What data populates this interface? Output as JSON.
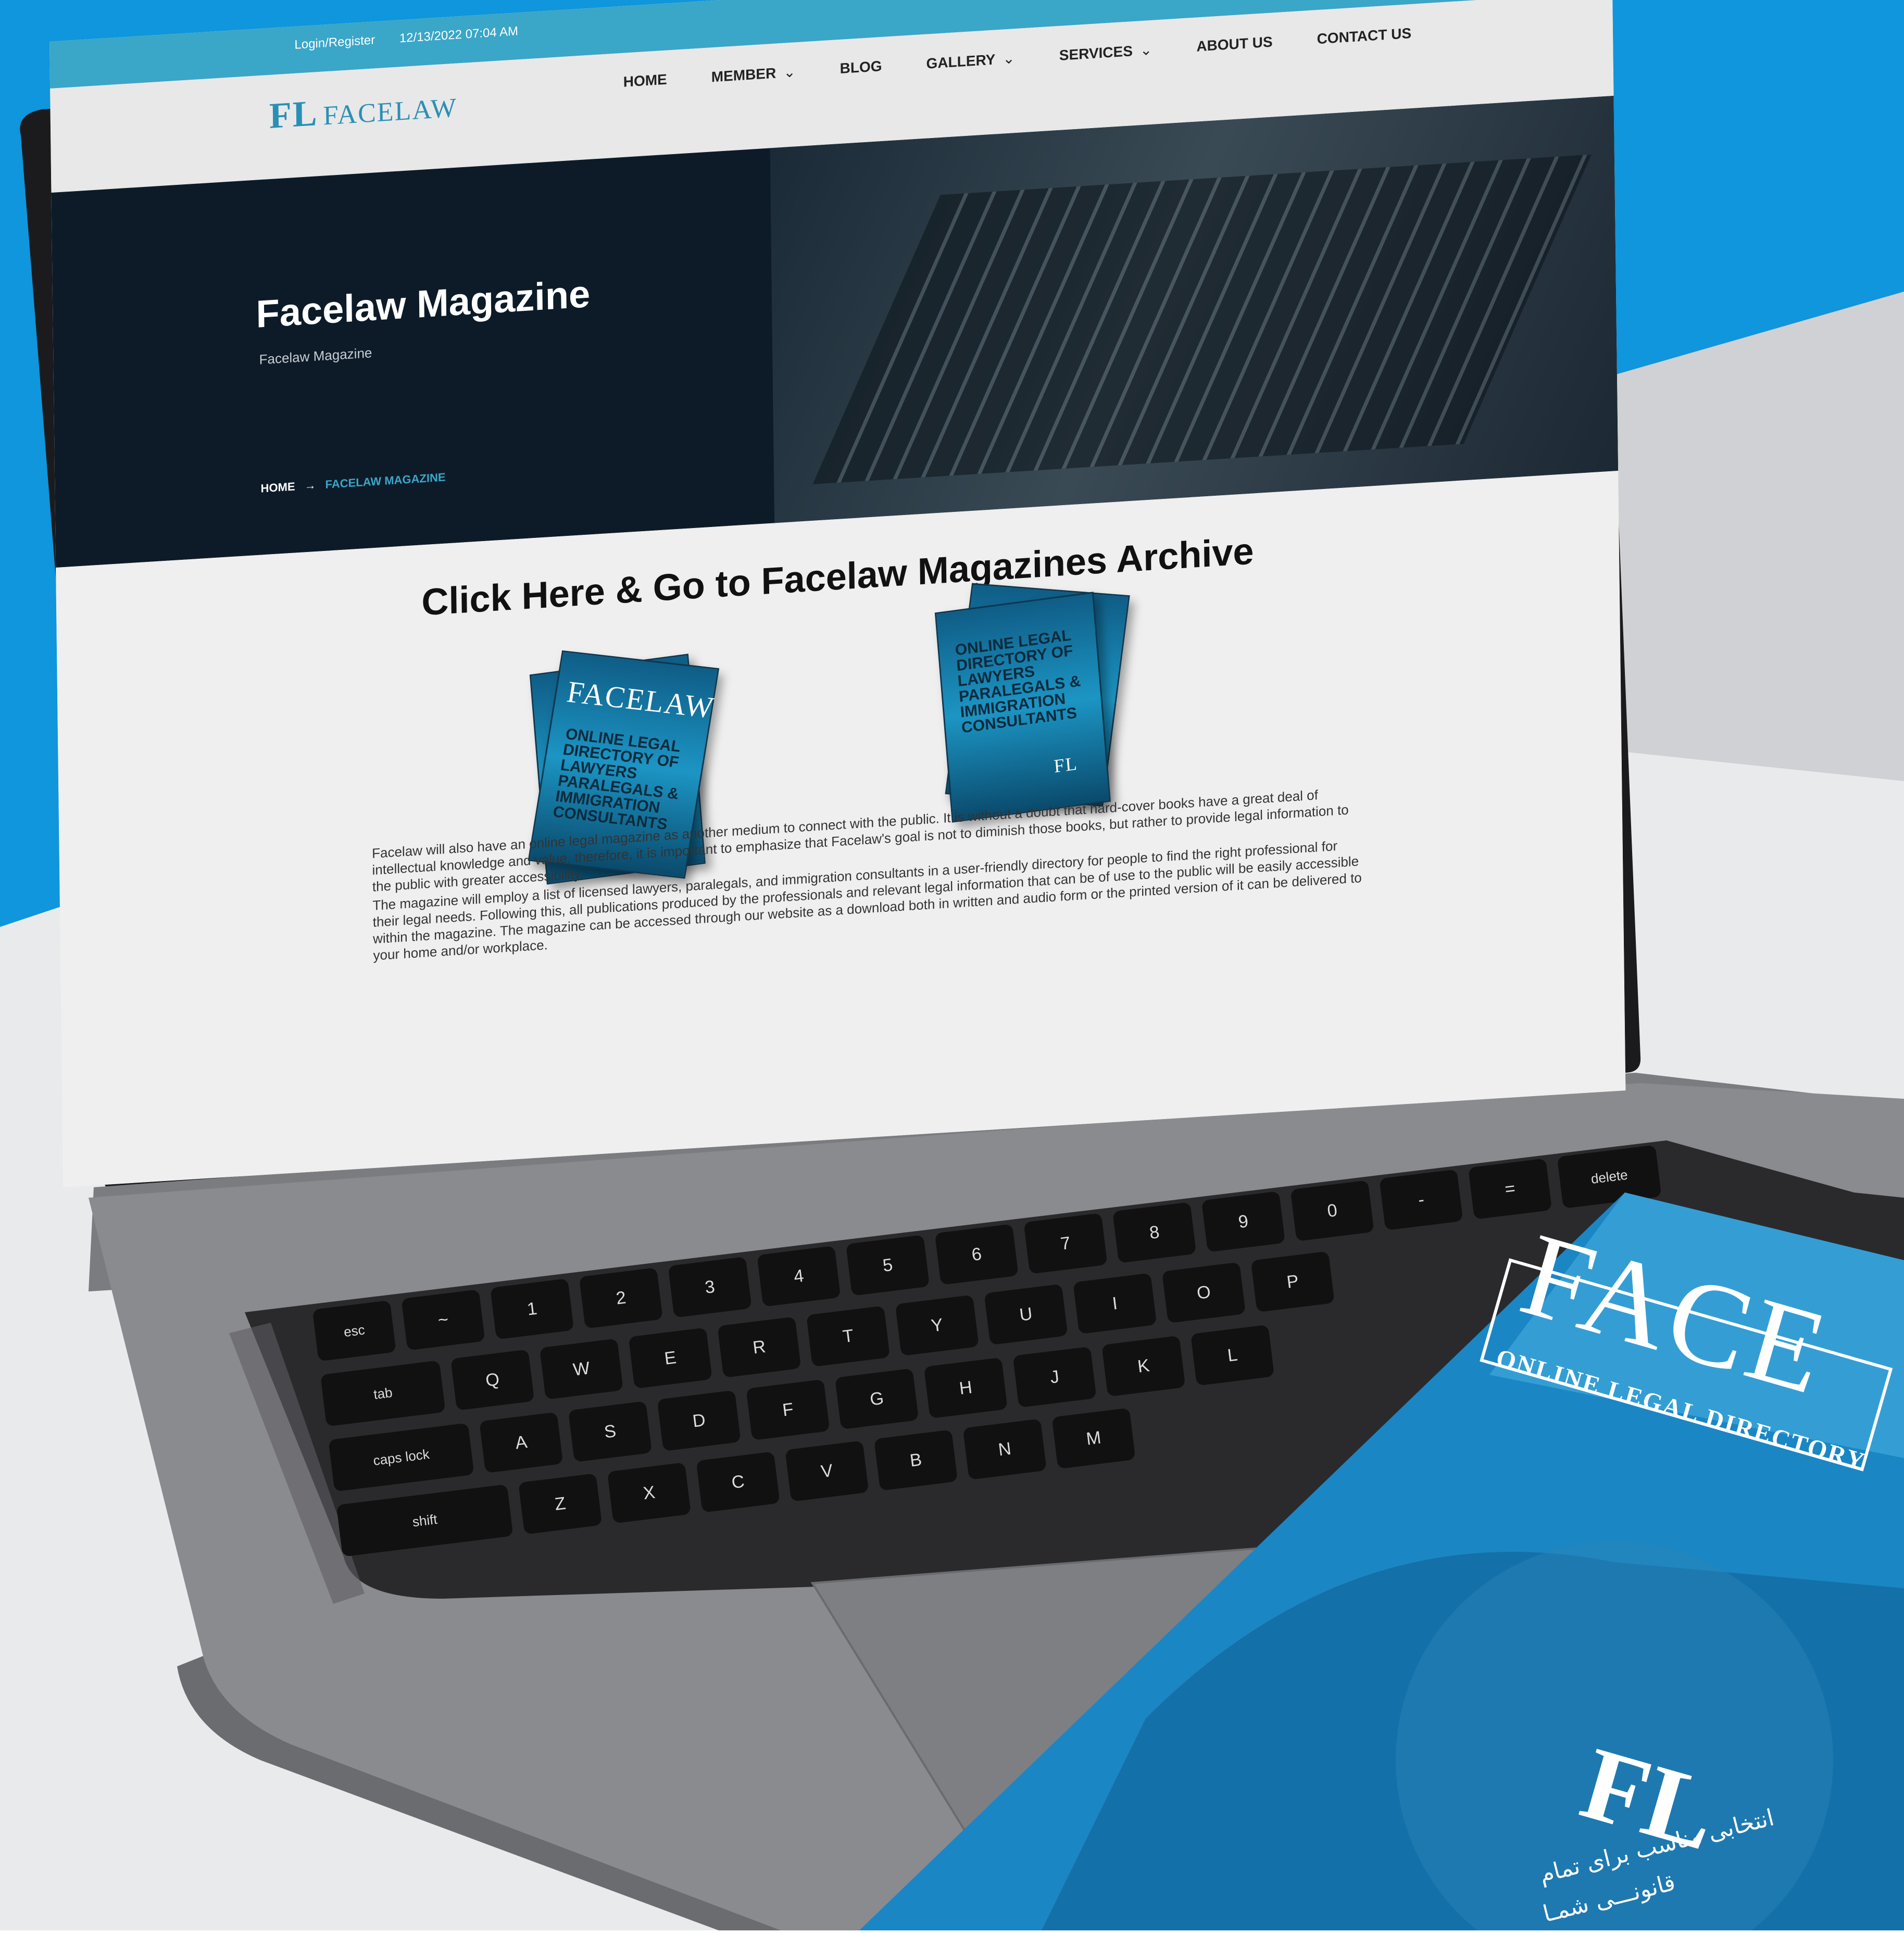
{
  "topbar": {
    "login_label": "Login/Register",
    "datetime": "12/13/2022 07:04 AM",
    "social_icons": [
      "instagram-icon",
      "youtube-icon",
      "facebook-icon"
    ]
  },
  "brand": {
    "mark": "FL",
    "name": "FACELAW",
    "color": "#2a8fb5"
  },
  "nav": {
    "items": [
      {
        "label": "HOME",
        "dropdown": false
      },
      {
        "label": "MEMBER",
        "dropdown": true
      },
      {
        "label": "BLOG",
        "dropdown": false
      },
      {
        "label": "GALLERY",
        "dropdown": true
      },
      {
        "label": "SERVICES",
        "dropdown": true
      },
      {
        "label": "ABOUT US",
        "dropdown": false
      },
      {
        "label": "CONTACT US",
        "dropdown": false
      }
    ]
  },
  "hero": {
    "title": "Facelaw Magazine",
    "subtitle": "Facelaw Magazine",
    "breadcrumb": {
      "home": "HOME",
      "arrow": "→",
      "current": "FACELAW MAGAZINE"
    }
  },
  "main": {
    "archive_link": "Click Here & Go to Facelaw Magazines Archive",
    "magazines": [
      {
        "cover_title": "FACELAW",
        "cover_text": "ONLINE LEGAL DIRECTORY OF LAWYERS PARALEGALS & IMMIGRATION CONSULTANTS"
      },
      {
        "cover_title": "FL",
        "cover_text": "ONLINE LEGAL DIRECTORY OF LAWYERS PARALEGALS & IMMIGRATION CONSULTANTS"
      }
    ],
    "paragraphs": [
      "Facelaw will also have an online legal magazine as another medium to connect with the public. It is without a doubt that hard-cover books have a great deal of intellectual knowledge and value, therefore, it is important to emphasize that Facelaw's goal is not to diminish those books, but rather to provide legal information to the public with greater accessibility.",
      "The magazine will employ a list of licensed lawyers, paralegals, and immigration consultants in a user-friendly directory for people to find the right professional for their legal needs. Following this, all publications produced by the professionals and relevant legal information that can be of use to the public will be easily accessible within the magazine. The magazine can be accessed through our website as a download both in written and audio form or the printed version of it can be delivered to your home and/or workplace."
    ]
  },
  "keyboard": {
    "keys": [
      "esc",
      "~",
      "1",
      "2",
      "3",
      "4",
      "5",
      "6",
      "7",
      "8",
      "9",
      "0",
      "-",
      "=",
      "delete",
      "tab",
      "Q",
      "W",
      "E",
      "R",
      "T",
      "Y",
      "U",
      "I",
      "O",
      "P",
      "caps lock",
      "A",
      "S",
      "D",
      "F",
      "G",
      "H",
      "J",
      "K",
      "L",
      "shift",
      "Z",
      "X",
      "C",
      "V",
      "B",
      "N",
      "M"
    ]
  },
  "brochure": {
    "title": "FACE",
    "tagline": "ONLINE LEGAL DIRECTORY",
    "mark": "FL",
    "rtl_line1": "انتخابی مناسب برای تمام",
    "rtl_line2": "قانونـــی شمـا"
  },
  "colors": {
    "sky_blue": "#0f96dc",
    "accent": "#3aa6c8",
    "hero_dark": "#0d1b28"
  }
}
